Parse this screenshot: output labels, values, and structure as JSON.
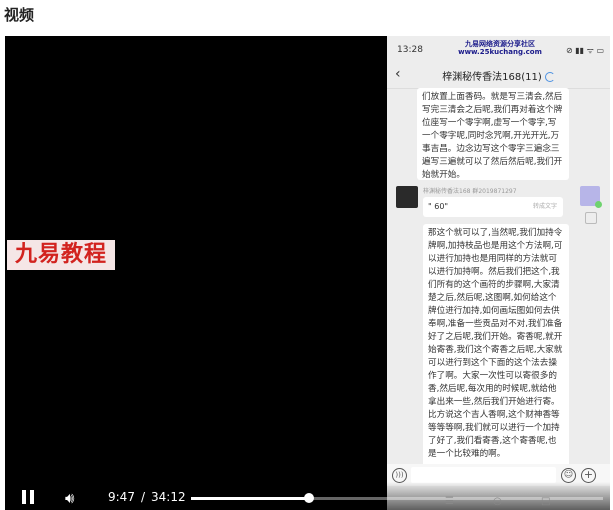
{
  "section": {
    "title": "视频"
  },
  "video": {
    "watermark": "九易教程",
    "current_time": "9:47",
    "separator": "/",
    "total_time": "34:12",
    "progress_fraction": 0.286
  },
  "phone": {
    "status": {
      "time": "13:28",
      "site_line1": "九易网络资源分享社区",
      "site_line2": "www.25kuchang.com",
      "icons": "⊘ ▮▮ ᯤ ▭"
    },
    "chat": {
      "title": "梓渊秘传香法168(11)",
      "message1": "们放置上面香码。就是写三清会,然后写完三清会之后呢,我们再对着这个牌位座写一个零字啊,虚写一个零字,写一个零字呢,同时念咒啊,开光开光,万事吉昌。边念边写这个零字三遍念三遍写三遍就可以了然后然后呢,我们开始就开始。",
      "sender": "梓渊秘传香法168 群2019871297",
      "voice_message": "\" 60\"",
      "voice_tag": "转成文字",
      "message2": "那这个就可以了,当然呢,我们加持令牌啊,加持枝品也是用这个方法啊,可以进行加持也是用同样的方法就可以进行加持啊。然后我们把这个,我们所有的这个画符的步骤啊,大家清楚之后,然后呢,这图啊,如何给这个牌位进行加持,如何画坛图如何去供奉啊,准备一些贡品对不对,我们准备好了之后呢,我们开始。寄香呢,就开始寄香,我们这个寄香之后呢,大家就可以进行到这个下面的这个法去操作了啊。大家一次性可以寄很多的香,然后呢,每次用的时候呢,就给他拿出来一些,然后我们开始进行寄。比方说这个吉人香啊,这个财神香等等等等啊,我们就可以进行一个加持了好了,我们看寄香,这个寄香呢,也是一个比较难的啊。"
    }
  },
  "colors": {
    "watermark_red": "#d2231f",
    "chat_background": "#ededed",
    "player_background": "#000000"
  }
}
